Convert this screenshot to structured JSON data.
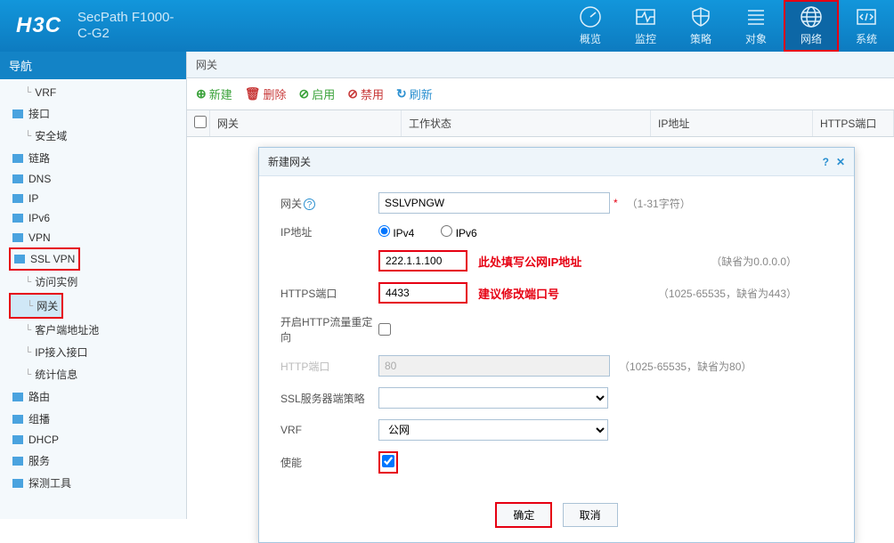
{
  "header": {
    "logo": "H3C",
    "product": "SecPath F1000-C-G2"
  },
  "topnav": [
    {
      "label": "概览",
      "icon": "gauge"
    },
    {
      "label": "监控",
      "icon": "monitor"
    },
    {
      "label": "策略",
      "icon": "shield"
    },
    {
      "label": "对象",
      "icon": "list"
    },
    {
      "label": "网络",
      "icon": "globe",
      "active": true
    },
    {
      "label": "系统",
      "icon": "code"
    }
  ],
  "sidebar": {
    "title": "导航",
    "items": [
      {
        "label": "VRF",
        "lvl": 1,
        "folder": false
      },
      {
        "label": "接口",
        "lvl": 0,
        "folder": true
      },
      {
        "label": "安全域",
        "lvl": 1,
        "folder": false
      },
      {
        "label": "链路",
        "lvl": 0,
        "folder": true
      },
      {
        "label": "DNS",
        "lvl": 0,
        "folder": true
      },
      {
        "label": "IP",
        "lvl": 0,
        "folder": true
      },
      {
        "label": "IPv6",
        "lvl": 0,
        "folder": true
      },
      {
        "label": "VPN",
        "lvl": 0,
        "folder": true
      },
      {
        "label": "SSL VPN",
        "lvl": 0,
        "folder": true,
        "redbox": true
      },
      {
        "label": "访问实例",
        "lvl": 1,
        "folder": false
      },
      {
        "label": "网关",
        "lvl": 1,
        "folder": false,
        "selected": true,
        "redbox": true
      },
      {
        "label": "客户端地址池",
        "lvl": 1,
        "folder": false
      },
      {
        "label": "IP接入接口",
        "lvl": 1,
        "folder": false
      },
      {
        "label": "统计信息",
        "lvl": 1,
        "folder": false
      },
      {
        "label": "路由",
        "lvl": 0,
        "folder": true
      },
      {
        "label": "组播",
        "lvl": 0,
        "folder": true
      },
      {
        "label": "DHCP",
        "lvl": 0,
        "folder": true
      },
      {
        "label": "服务",
        "lvl": 0,
        "folder": true
      },
      {
        "label": "探测工具",
        "lvl": 0,
        "folder": true
      }
    ]
  },
  "content": {
    "crumb": "网关",
    "toolbar": {
      "add": "新建",
      "del": "删除",
      "enable": "启用",
      "disable": "禁用",
      "refresh": "刷新"
    },
    "columns": {
      "gw": "网关",
      "state": "工作状态",
      "ip": "IP地址",
      "port": "HTTPS端口"
    }
  },
  "dialog": {
    "title": "新建网关",
    "fields": {
      "gw_label": "网关",
      "gw_value": "SSLVPNGW",
      "gw_hint": "（1-31字符）",
      "ip_label": "IP地址",
      "ipv4_label": "IPv4",
      "ipv6_label": "IPv6",
      "ip_value": "222.1.1.100",
      "ip_annot": "此处填写公网IP地址",
      "ip_hint": "（缺省为0.0.0.0）",
      "https_label": "HTTPS端口",
      "https_value": "4433",
      "https_annot": "建议修改端口号",
      "https_hint": "（1025-65535，缺省为443）",
      "redirect_label": "开启HTTP流量重定向",
      "http_label": "HTTP端口",
      "http_value": "80",
      "http_hint": "（1025-65535，缺省为80）",
      "ssl_label": "SSL服务器端策略",
      "vrf_label": "VRF",
      "vrf_value": "公网",
      "enable_label": "使能"
    },
    "buttons": {
      "ok": "确定",
      "cancel": "取消"
    }
  }
}
